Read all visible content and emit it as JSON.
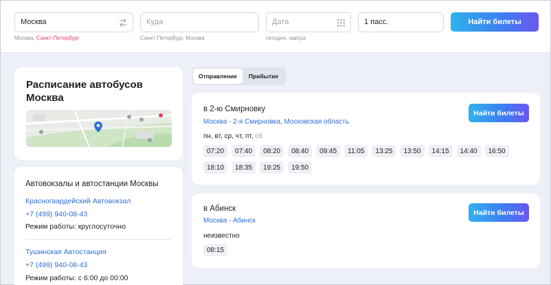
{
  "search": {
    "from_value": "Москва",
    "from_hint_prefix": "Москва, ",
    "from_hint_link": "Санкт-Петербург",
    "to_placeholder": "Куда",
    "to_hint": "Санкт-Петербург, Москва",
    "date_placeholder": "Дата",
    "date_hint": "сегодня, завтра",
    "passengers": "1 пасс.",
    "find_label": "Найти билеты"
  },
  "sidebar": {
    "title": "Расписание автобусов Москва",
    "stations_heading": "Автовокзалы и автостанции Москвы",
    "stations": [
      {
        "name": "Красногвардейский Автовокзал",
        "phone": "+7 (499) 940-08-43",
        "hours": "Режим работы: круглосуточно"
      },
      {
        "name": "Тушинская Автостанция",
        "phone": "+7 (499) 940-08-43",
        "hours": "Режим работы: с 6:00 до 00:00"
      }
    ]
  },
  "tabs": [
    {
      "label": "Отправление",
      "active": true
    },
    {
      "label": "Прибытие",
      "active": false
    }
  ],
  "routes": [
    {
      "title": "в 2-ю Смирновку",
      "subtitle": "Москва - 2-я Смирновка, Московская область",
      "days_main": "пн, вт, ср, чт, пт, ",
      "days_muted": "сб",
      "times": [
        "07:20",
        "07:40",
        "08:20",
        "08:40",
        "09:45",
        "11:05",
        "13:25",
        "13:50",
        "14:15",
        "14:40",
        "16:50",
        "18:10",
        "18:35",
        "19:25",
        "19:50"
      ],
      "button": "Найти билеты"
    },
    {
      "title": "в Абинск",
      "subtitle": "Москва - Абинск",
      "days_main": "неизвестно",
      "times": [
        "08:15"
      ],
      "button": "Найти билеты"
    }
  ],
  "colors": {
    "accent_link": "#2f6fd6",
    "hint_pink": "#e4406a",
    "button_gradient_start": "#2fb2ee",
    "button_gradient_end": "#6b57f0",
    "page_bg": "#edf0f7"
  }
}
